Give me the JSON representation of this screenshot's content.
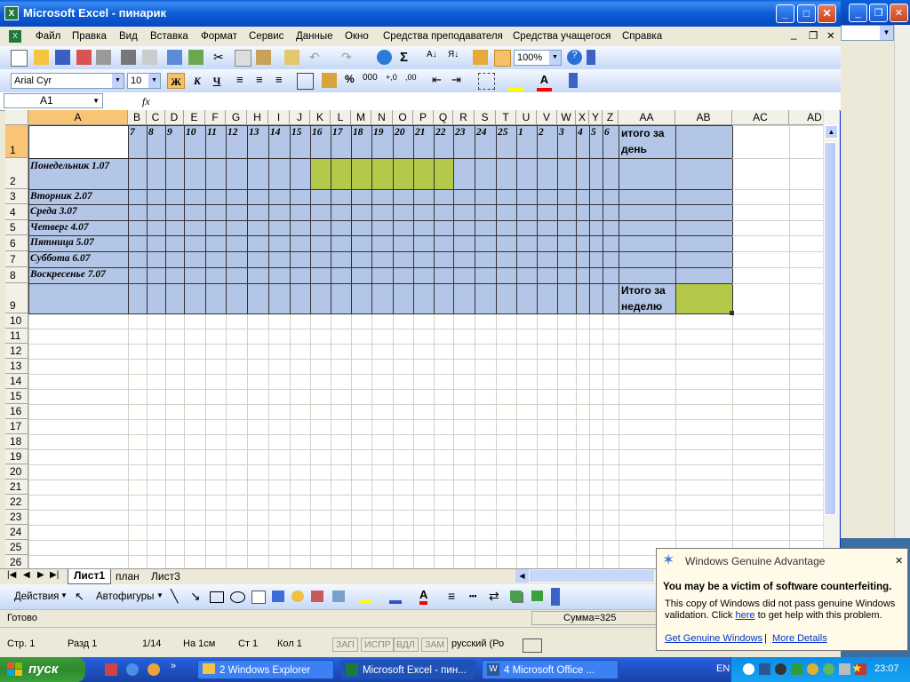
{
  "window": {
    "title": "Microsoft Excel - пинарик",
    "icon": "excel-icon"
  },
  "menu": [
    "Файл",
    "Правка",
    "Вид",
    "Вставка",
    "Формат",
    "Сервис",
    "Данные",
    "Окно",
    "Средства преподавателя",
    "Средства учащегося",
    "Справка"
  ],
  "toolbar": {
    "zoom": "100%",
    "font": "Arial Cyr",
    "size": "10",
    "bold": "Ж",
    "italic": "К",
    "underline": "Ч",
    "percent": "%",
    "thousands": "000"
  },
  "formula_bar": {
    "cell_ref": "A1",
    "fx": "fx",
    "value": ""
  },
  "columns": [
    "A",
    "B",
    "C",
    "D",
    "E",
    "F",
    "G",
    "H",
    "I",
    "J",
    "K",
    "L",
    "M",
    "N",
    "O",
    "P",
    "Q",
    "R",
    "S",
    "T",
    "U",
    "V",
    "W",
    "X",
    "Y",
    "Z",
    "AA",
    "AB",
    "AC",
    "AD"
  ],
  "rows": [
    "1",
    "2",
    "3",
    "4",
    "5",
    "6",
    "7",
    "8",
    "9",
    "10",
    "11",
    "12",
    "13",
    "14",
    "15",
    "16",
    "17",
    "18",
    "19",
    "20",
    "21",
    "22",
    "23",
    "24",
    "25",
    "26"
  ],
  "sheet": {
    "header_numbers": [
      "7",
      "8",
      "9",
      "10",
      "11",
      "12",
      "13",
      "14",
      "15",
      "16",
      "17",
      "18",
      "19",
      "20",
      "21",
      "22",
      "23",
      "24",
      "25",
      "1",
      "2",
      "3",
      "4",
      "5",
      "6"
    ],
    "total_day_line1": "итого за",
    "total_day_line2": "день",
    "days": [
      "Понедельник 1.07",
      "Вторник 2.07",
      "Среда 3.07",
      "Четверг 4.07",
      "Пятница 5.07",
      "Суббота 6.07",
      "Воскресенье 7.07"
    ],
    "total_week_line1": "Итого за",
    "total_week_line2": "неделю",
    "colors": {
      "fill": "#b4c6e7",
      "highlight": "#b4c94a"
    }
  },
  "sheet_tabs": [
    "Лист1",
    "план",
    "Лист3"
  ],
  "draw_toolbar": {
    "actions": "Действия",
    "autoshapes": "Автофигуры"
  },
  "status": {
    "ready": "Готово",
    "sum": "Сумма=325",
    "page": "Стр. 1",
    "section": "Разд 1",
    "pages": "1/14",
    "at": "На 1см",
    "line": "Ст 1",
    "col": "Кол 1",
    "rec": "ЗАП",
    "trk": "ИСПР",
    "ext": "ВДЛ",
    "ovr": "ЗАМ",
    "lang": "русский (Ро"
  },
  "taskbar": {
    "start": "пуск",
    "tasks": [
      "2 Windows Explorer",
      "Microsoft Excel - пин...",
      "4 Microsoft Office ..."
    ],
    "lang": "EN",
    "time": "23:07"
  },
  "popup": {
    "title": "Windows Genuine Advantage",
    "heading": "You may be a victim of software counterfeiting.",
    "body1": "This copy of Windows did not pass genuine Windows",
    "body2a": "validation. Click ",
    "body2_link": "here",
    "body2b": " to get help with this problem.",
    "link1": "Get Genuine Windows",
    "separator": "|",
    "link2": "More Details"
  }
}
